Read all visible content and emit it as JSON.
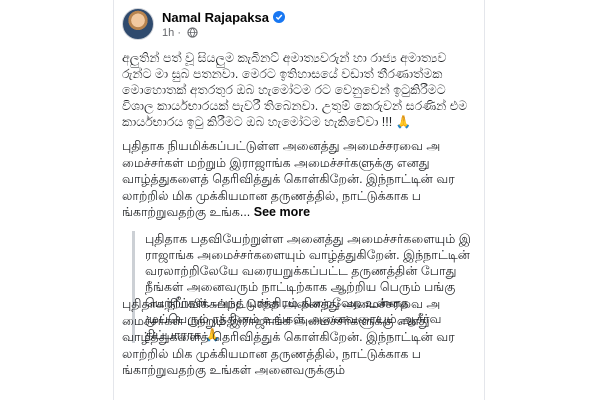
{
  "post": {
    "author": "Namal Rajapaksa",
    "time": "1h",
    "sep": "·",
    "sinhala_text": "අලුතින් පත් වූ සියලුම කැබිනට් අමාත්‍යවරුන් හා රාජ්‍ය අමාත්‍යවරුන්ට මා සුබ පතනවා. මෙරට ඉතිහාසයේ වඩාත් තීරණාත්මක මොහොතක් අතරතුර ඔබ හැමෝටම රට වෙනුවෙන් ඉටුකිරීමට විශාල කාර්යභාරයක් පැවරී තිබෙනවා. උතුම් කෙරුවන් සරණින් එම කාර්යභාරය ඉටු කිරීමට ඔබ හැමෝටම හැකිවේවා !!! 🙏",
    "tamil_text": "புதிதாக நியமிக்கப்பட்டுள்ள அனைத்து அமைச்சரவை அமைச்சர்கள் மற்றும் இராஜாங்க அமைச்சர்களுக்கு எனது வாழ்த்துகளைத் தெரிவித்துக் கொள்கிறேன். இந்நாட்டின் வரலாற்றில் மிக முக்கியமான தருணத்தில், நாட்டுக்காக பங்காற்றுவதற்கு உங்க...",
    "see_more": "See more",
    "quote_text": "புதிதாக பதவியேற்றுள்ள அனைத்து அமைச்சர்களையும் இராஜாங்க அமைச்சர்களையும் வாழ்த்துகிறேன். இந்நாட்டின் வரலாற்றிலேயே வரையறுக்கப்பட்ட தருணத்தின் போது நீங்கள் அனைவரும் நாட்டிற்காக ஆற்றிய பெரும் பங்கு பெற்றீர்கள். அந்த பாத்திரம் நிறைவேற உன்னத முப்பெரும் ரத்தினம் உங்கள் அனைவரையும் ஆசீர்வதிப்பாராக 🙏",
    "lower_text": "புதிதாக நியமிக்கப்பட்டுள்ள அனைத்து அமைச்சரவை அமைச்சர்கள் மற்றும் இராஜாங்க அமைச்சர்களுக்கு எனது வாழ்த்துகளைத் தெரிவித்துக் கொள்கிறேன். இந்நாட்டின் வரலாற்றில் மிக முக்கியமான தருணத்தில், நாட்டுக்காக பங்காற்றுவதற்கு உங்கள் அனைவருக்கும்"
  },
  "icons": {
    "verified": "verified-badge-icon",
    "audience": "globe-icon"
  },
  "colors": {
    "verified": "#1877f2",
    "meta": "#65676b",
    "text": "#1c1e21"
  }
}
